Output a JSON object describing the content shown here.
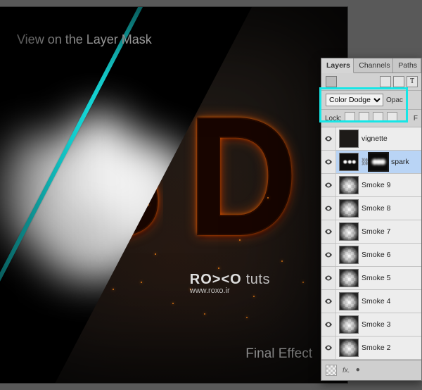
{
  "captions": {
    "top": "View on the Layer Mask",
    "bottom": "Final Effect"
  },
  "brand": {
    "name": "RO><O",
    "suffix": "tuts",
    "url": "www.roxo.ir"
  },
  "artwork": {
    "letter_left": "S",
    "letter_right": "D"
  },
  "panel": {
    "tabs": {
      "layers": "Layers",
      "channels": "Channels",
      "paths": "Paths"
    },
    "blend_mode": "Color Dodge",
    "opacity_label": "Opac",
    "lock_label": "Lock:",
    "fill_label_short": "F",
    "layers": [
      {
        "name": "vignette"
      },
      {
        "name": "spark"
      },
      {
        "name": "Smoke 9"
      },
      {
        "name": "Smoke 8"
      },
      {
        "name": "Smoke 7"
      },
      {
        "name": "Smoke 6"
      },
      {
        "name": "Smoke 5"
      },
      {
        "name": "Smoke 4"
      },
      {
        "name": "Smoke 3"
      },
      {
        "name": "Smoke 2"
      }
    ],
    "footer_fx": "fx."
  },
  "colors": {
    "highlight": "#16e6e6"
  }
}
